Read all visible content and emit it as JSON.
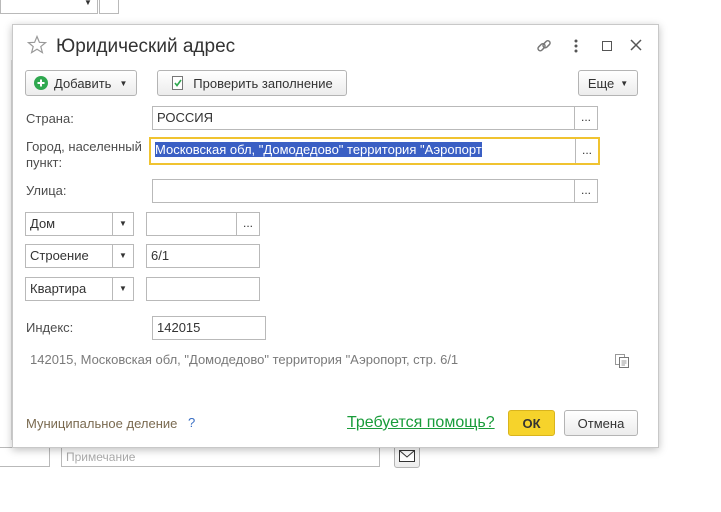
{
  "background_form": {
    "note_placeholder": "Примечание"
  },
  "dialog": {
    "title": "Юридический адрес",
    "toolbar": {
      "add_label": "Добавить",
      "check_label": "Проверить заполнение",
      "more_label": "Еще"
    },
    "fields": {
      "country_label": "Страна:",
      "country_value": "РОССИЯ",
      "city_label_line1": "Город, населенный",
      "city_label_line2": "пункт:",
      "city_value": "Московская обл, \"Домодедово\" территория \"Аэропорт",
      "street_label": "Улица:",
      "street_value": "",
      "house_type": "Дом",
      "house_value": "",
      "building_type": "Строение",
      "building_value": "6/1",
      "apartment_type": "Квартира",
      "apartment_value": "",
      "index_label": "Индекс:",
      "index_value": "142015"
    },
    "full_address": "142015, Московская обл, \"Домодедово\" территория \"Аэропорт, стр. 6/1",
    "footer": {
      "municipal_label": "Муниципальное деление",
      "municipal_help": "?",
      "help_link": "Требуется помощь?",
      "ok_label": "ОК",
      "cancel_label": "Отмена"
    },
    "dots_label": "...",
    "colors": {
      "accent_yellow": "#f6d32b",
      "link_green": "#199c3a",
      "selection_blue": "#3a5fc4",
      "focus_border": "#f0c330"
    }
  }
}
